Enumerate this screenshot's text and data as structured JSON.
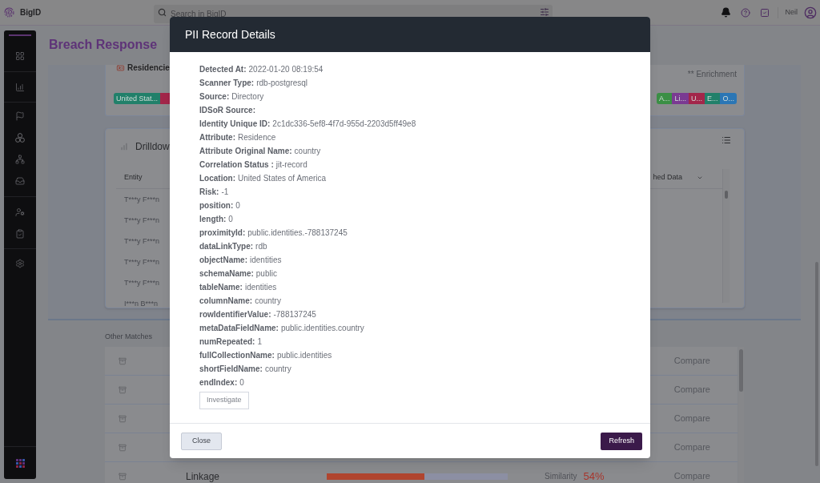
{
  "top_bar": {
    "logo": "BigID",
    "search": {
      "placeholder": "Search in BigID"
    },
    "user_name": "Neil"
  },
  "page": {
    "title": "Breach Response"
  },
  "residency_card": {
    "title": "Residencie",
    "note": "** Enrichment",
    "tags_left": [
      {
        "label": "United Stat...",
        "color": "#21806a"
      },
      {
        "color": "#a3264a"
      }
    ],
    "tags_right": [
      {
        "label": "A...",
        "color": "#3b8f45"
      },
      {
        "label": "Li...",
        "color": "#7a3a92"
      },
      {
        "label": "U...",
        "color": "#a3264a"
      },
      {
        "label": "E...",
        "color": "#21806a"
      },
      {
        "label": "O...",
        "color": "#2b76b5"
      }
    ]
  },
  "drilldown_card": {
    "title": "Drilldow",
    "columns": [
      "Entity",
      "hed Data"
    ],
    "rows": [
      "T***y F***n",
      "T***y F***n",
      "T***y F***n",
      "T***y F***n",
      "T***y F***n",
      "I***n B***n"
    ]
  },
  "other_matches": {
    "title": "Other Matches",
    "rows": [
      {
        "action": "Compare"
      },
      {
        "action": "Compare"
      },
      {
        "action": "Compare"
      },
      {
        "action": "Compare"
      },
      {
        "label": "Linkage",
        "level": 0.54,
        "similarity_label": "Similarity",
        "similarity": "54%",
        "action": "Compare"
      }
    ]
  },
  "modal": {
    "title": "PII Record Details",
    "fields": [
      {
        "label": "Detected At:",
        "value": "2022-01-20 08:19:54"
      },
      {
        "label": "Scanner Type:",
        "value": "rdb-postgresql"
      },
      {
        "label": "Source:",
        "value": "Directory"
      },
      {
        "label": "IDSoR Source:"
      },
      {
        "label": "Identity Unique ID:",
        "value": "2c1dc336-5ef8-4f7d-955d-2203d5ff49e8"
      },
      {
        "label": "Attribute:",
        "value": "Residence"
      },
      {
        "label": "Attribute Original Name:",
        "value": "country"
      },
      {
        "label": "Correlation Status :",
        "value": "jit-record"
      },
      {
        "label": "Location:",
        "value": "United States of America"
      },
      {
        "label": "Risk:",
        "value": "-1"
      },
      {
        "label": "position:",
        "value": "0"
      },
      {
        "label": "length:",
        "value": "0"
      },
      {
        "label": "proximityId:",
        "value": "public.identities.-788137245"
      },
      {
        "label": "dataLinkType:",
        "value": "rdb"
      },
      {
        "label": "objectName:",
        "value": "identities"
      },
      {
        "label": "schemaName:",
        "value": "public"
      },
      {
        "label": "tableName:",
        "value": "identities"
      },
      {
        "label": "columnName:",
        "value": "country"
      },
      {
        "label": "rowIdentifierValue:",
        "value": "-788137245"
      },
      {
        "label": "metaDataFieldName:",
        "value": "public.identities.country"
      },
      {
        "label": "numRepeated:",
        "value": "1"
      },
      {
        "label": "fullCollectionName:",
        "value": "public.identities"
      },
      {
        "label": "shortFieldName:",
        "value": "country"
      },
      {
        "label": "endIndex:",
        "value": "0"
      }
    ],
    "investigate_button": "Investigate",
    "buttons": [
      {
        "label": "Close",
        "kind": "secondary"
      },
      {
        "label": "Refresh",
        "kind": "primary"
      }
    ]
  }
}
